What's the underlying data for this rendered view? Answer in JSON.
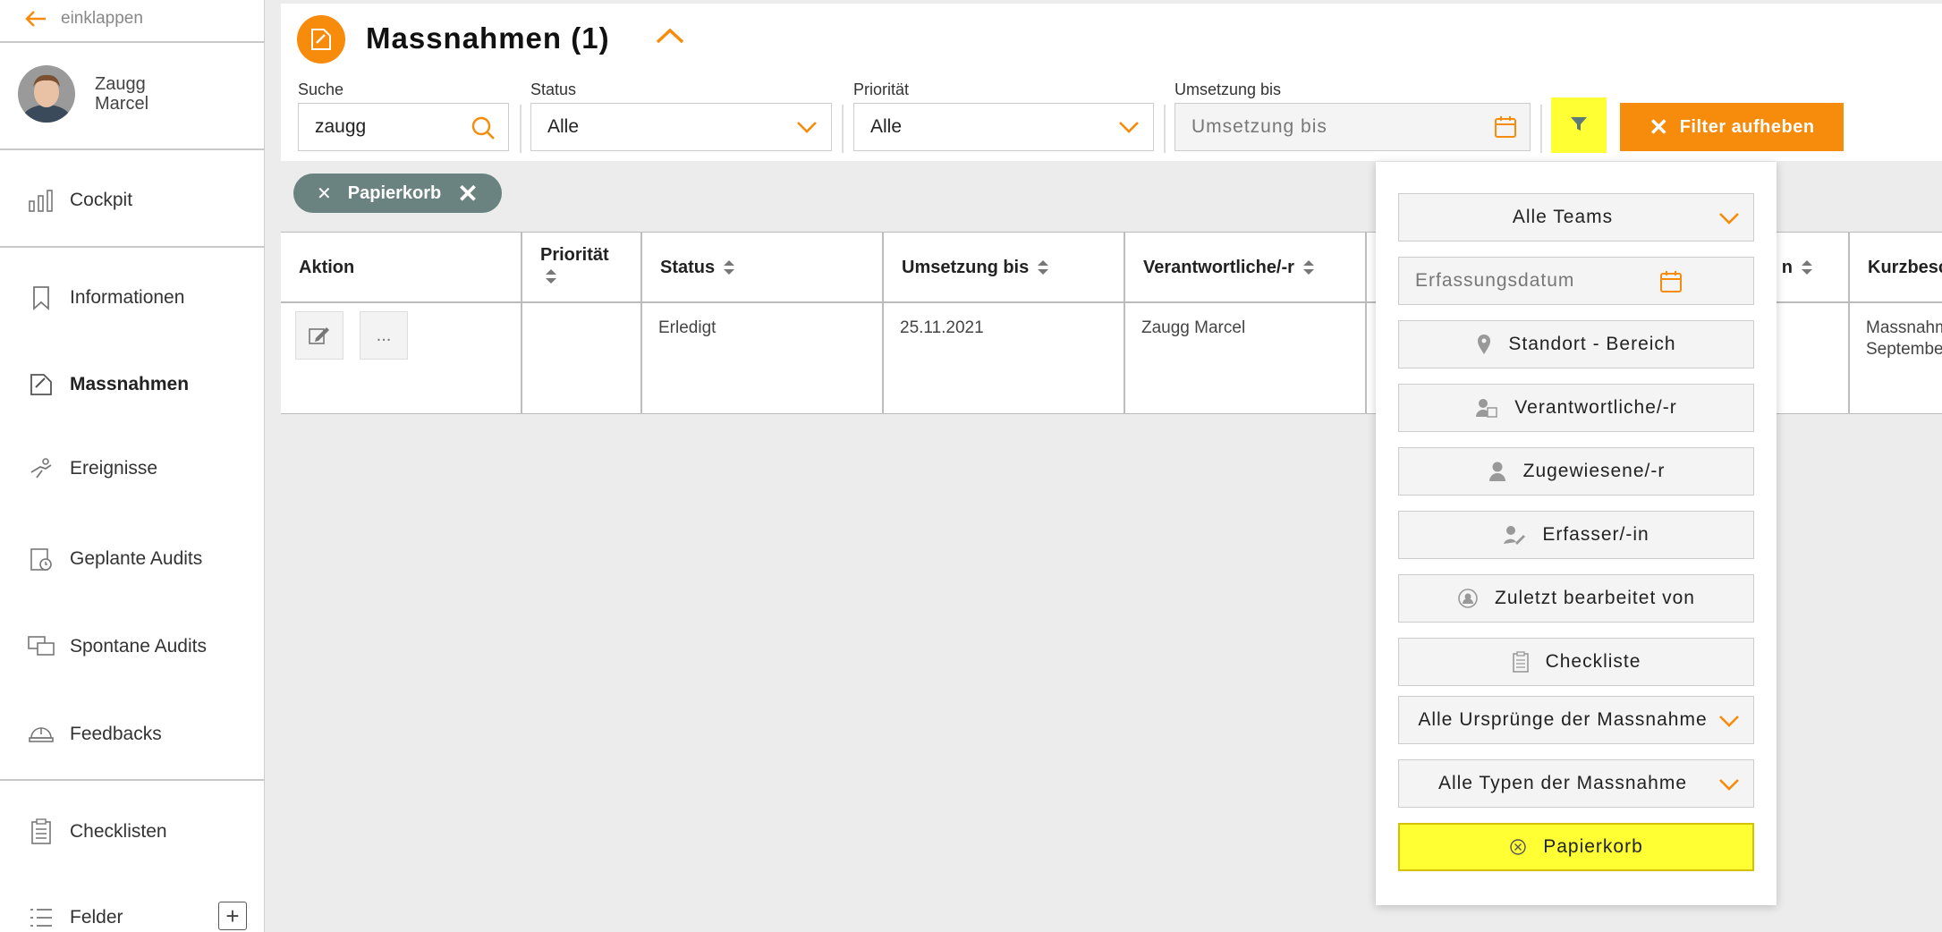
{
  "sidebar": {
    "collapse_label": "einklappen",
    "user_first": "Zaugg",
    "user_last": "Marcel",
    "items": [
      {
        "label": "Cockpit",
        "icon": "bar-chart-icon"
      },
      {
        "label": "Informationen",
        "icon": "bookmark-icon"
      },
      {
        "label": "Massnahmen",
        "icon": "measures-icon"
      },
      {
        "label": "Ereignisse",
        "icon": "incident-icon"
      },
      {
        "label": "Geplante Audits",
        "icon": "clipboard-clock-icon"
      },
      {
        "label": "Spontane Audits",
        "icon": "chat-bubbles-icon"
      },
      {
        "label": "Feedbacks",
        "icon": "helmet-icon"
      },
      {
        "label": "Checklisten",
        "icon": "clipboard-icon"
      },
      {
        "label": "Felder",
        "icon": "list-icon"
      }
    ]
  },
  "header": {
    "title": "Massnahmen (1)"
  },
  "filters": {
    "search_label": "Suche",
    "search_value": "zaugg",
    "status_label": "Status",
    "status_value": "Alle",
    "priority_label": "Priorität",
    "priority_value": "Alle",
    "date_label": "Umsetzung bis",
    "date_placeholder": "Umsetzung bis",
    "clear_label": "Filter aufheben"
  },
  "chip": {
    "label": "Papierkorb"
  },
  "table": {
    "headers": [
      "Aktion",
      "Priorität",
      "Status",
      "Umsetzung bis",
      "Verantwortliche/-r",
      "n",
      "Kurzbesc"
    ],
    "row": {
      "status": "Erledigt",
      "due": "25.11.2021",
      "responsible": "Zaugg Marcel",
      "desc_line1": "Massnahm",
      "desc_line2": "Septembe",
      "more_label": "..."
    }
  },
  "panel": {
    "teams": "Alle Teams",
    "capture_date": "Erfassungsdatum",
    "location": "Standort - Bereich",
    "responsible": "Verantwortliche/-r",
    "assigned": "Zugewiesene/-r",
    "creator": "Erfasser/-in",
    "last_edited": "Zuletzt bearbeitet von",
    "checklist": "Checkliste",
    "origins": "Alle Ursprünge der Massnahme",
    "types": "Alle Typen der Massnahme",
    "trash": "Papierkorb"
  },
  "colors": {
    "accent": "#f68b0c",
    "highlight": "#ffff33",
    "chip": "#6a8280"
  }
}
